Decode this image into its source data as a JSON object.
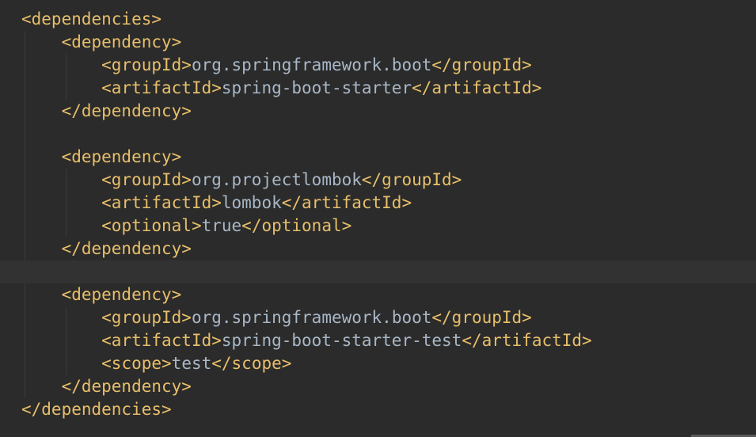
{
  "colors": {
    "background": "#2b2b2b",
    "current_line": "#323232",
    "tag": "#e8bf6a",
    "text": "#a9b7c6"
  },
  "lines": [
    {
      "indent": "",
      "open": "<dependencies>",
      "text": "",
      "close": ""
    },
    {
      "indent": "    ",
      "open": "<dependency>",
      "text": "",
      "close": ""
    },
    {
      "indent": "        ",
      "open": "<groupId>",
      "text": "org.springframework.boot",
      "close": "</groupId>"
    },
    {
      "indent": "        ",
      "open": "<artifactId>",
      "text": "spring-boot-starter",
      "close": "</artifactId>"
    },
    {
      "indent": "    ",
      "open": "</dependency>",
      "text": "",
      "close": ""
    },
    {
      "indent": "",
      "open": "",
      "text": "",
      "close": ""
    },
    {
      "indent": "    ",
      "open": "<dependency>",
      "text": "",
      "close": ""
    },
    {
      "indent": "        ",
      "open": "<groupId>",
      "text": "org.projectlombok",
      "close": "</groupId>"
    },
    {
      "indent": "        ",
      "open": "<artifactId>",
      "text": "lombok",
      "close": "</artifactId>"
    },
    {
      "indent": "        ",
      "open": "<optional>",
      "text": "true",
      "close": "</optional>"
    },
    {
      "indent": "    ",
      "open": "</dependency>",
      "text": "",
      "close": ""
    },
    {
      "indent": "",
      "open": "",
      "text": "",
      "close": "",
      "current": true
    },
    {
      "indent": "    ",
      "open": "<dependency>",
      "text": "",
      "close": ""
    },
    {
      "indent": "        ",
      "open": "<groupId>",
      "text": "org.springframework.boot",
      "close": "</groupId>"
    },
    {
      "indent": "        ",
      "open": "<artifactId>",
      "text": "spring-boot-starter-test",
      "close": "</artifactId>"
    },
    {
      "indent": "        ",
      "open": "<scope>",
      "text": "test",
      "close": "</scope>"
    },
    {
      "indent": "    ",
      "open": "</dependency>",
      "text": "",
      "close": ""
    },
    {
      "indent": "",
      "open": "</dependencies>",
      "text": "",
      "close": ""
    }
  ]
}
